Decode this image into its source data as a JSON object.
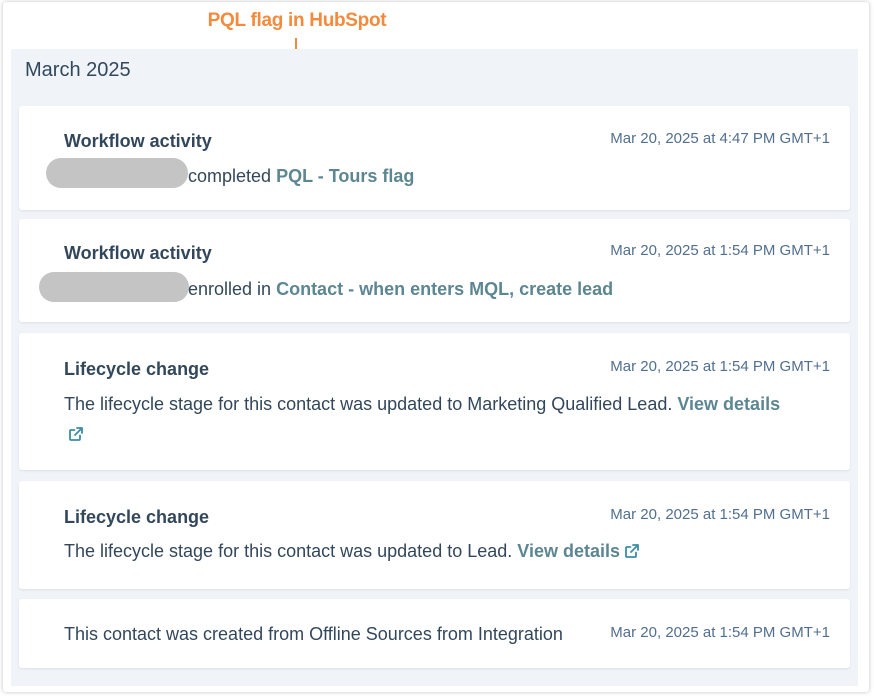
{
  "annotation": {
    "label": "PQL flag in HubSpot",
    "color": "#f58a3c"
  },
  "timeline": {
    "month": "March 2025",
    "events": [
      {
        "title": "Workflow activity",
        "timestamp": "Mar 20, 2025 at 4:47 PM GMT+1",
        "action": "completed",
        "link": "PQL - Tours flag"
      },
      {
        "title": "Workflow activity",
        "timestamp": "Mar 20, 2025 at 1:54 PM GMT+1",
        "action": "enrolled in",
        "link": "Contact - when enters MQL, create lead"
      },
      {
        "title": "Lifecycle change",
        "timestamp": "Mar 20, 2025 at 1:54 PM GMT+1",
        "text": "The lifecycle stage for this contact was updated to Marketing Qualified Lead.",
        "link": "View details",
        "icon": "external-link-icon"
      },
      {
        "title": "Lifecycle change",
        "timestamp": "Mar 20, 2025 at 1:54 PM GMT+1",
        "text": "The lifecycle stage for this contact was updated to Lead.",
        "link": "View details",
        "icon": "external-link-icon"
      },
      {
        "timestamp": "Mar 20, 2025 at 1:54 PM GMT+1",
        "text": "This contact was created from Offline Sources from Integration"
      }
    ]
  },
  "colors": {
    "link": "#3b8ea5",
    "text": "#33475b",
    "timestamp": "#516f90",
    "background": "#f0f4f8",
    "redaction": "#c4c4c4"
  }
}
